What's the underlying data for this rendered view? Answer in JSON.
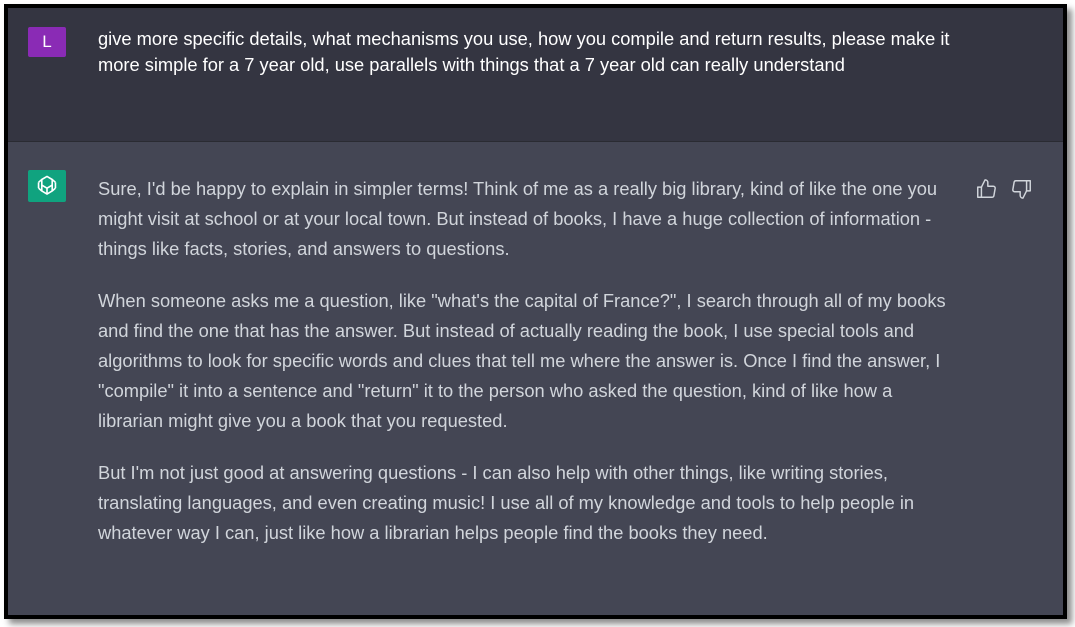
{
  "conversation": {
    "user_message": {
      "avatar_letter": "L",
      "text": "give more specific details, what mechanisms you use, how you compile and return results, please make it more simple for a 7 year old, use parallels with things that a 7 year old can really understand"
    },
    "assistant_message": {
      "paragraphs": [
        "Sure, I'd be happy to explain in simpler terms! Think of me as a really big library, kind of like the one you might visit at school or at your local town. But instead of books, I have a huge collection of information - things like facts, stories, and answers to questions.",
        "When someone asks me a question, like \"what's the capital of France?\", I search through all of my books and find the one that has the answer. But instead of actually reading the book, I use special tools and algorithms to look for specific words and clues that tell me where the answer is. Once I find the answer, I \"compile\" it into a sentence and \"return\" it to the person who asked the question, kind of like how a librarian might give you a book that you requested.",
        "But I'm not just good at answering questions - I can also help with other things, like writing stories, translating languages, and even creating music! I use all of my knowledge and tools to help people in whatever way I can, just like how a librarian helps people find the books they need."
      ],
      "feedback_icons": [
        "thumbs-up-icon",
        "thumbs-down-icon"
      ]
    }
  },
  "colors": {
    "user_row_bg": "#343541",
    "assistant_row_bg": "#444654",
    "user_avatar_bg": "#8a2bb5",
    "assistant_avatar_bg": "#10a37f"
  }
}
